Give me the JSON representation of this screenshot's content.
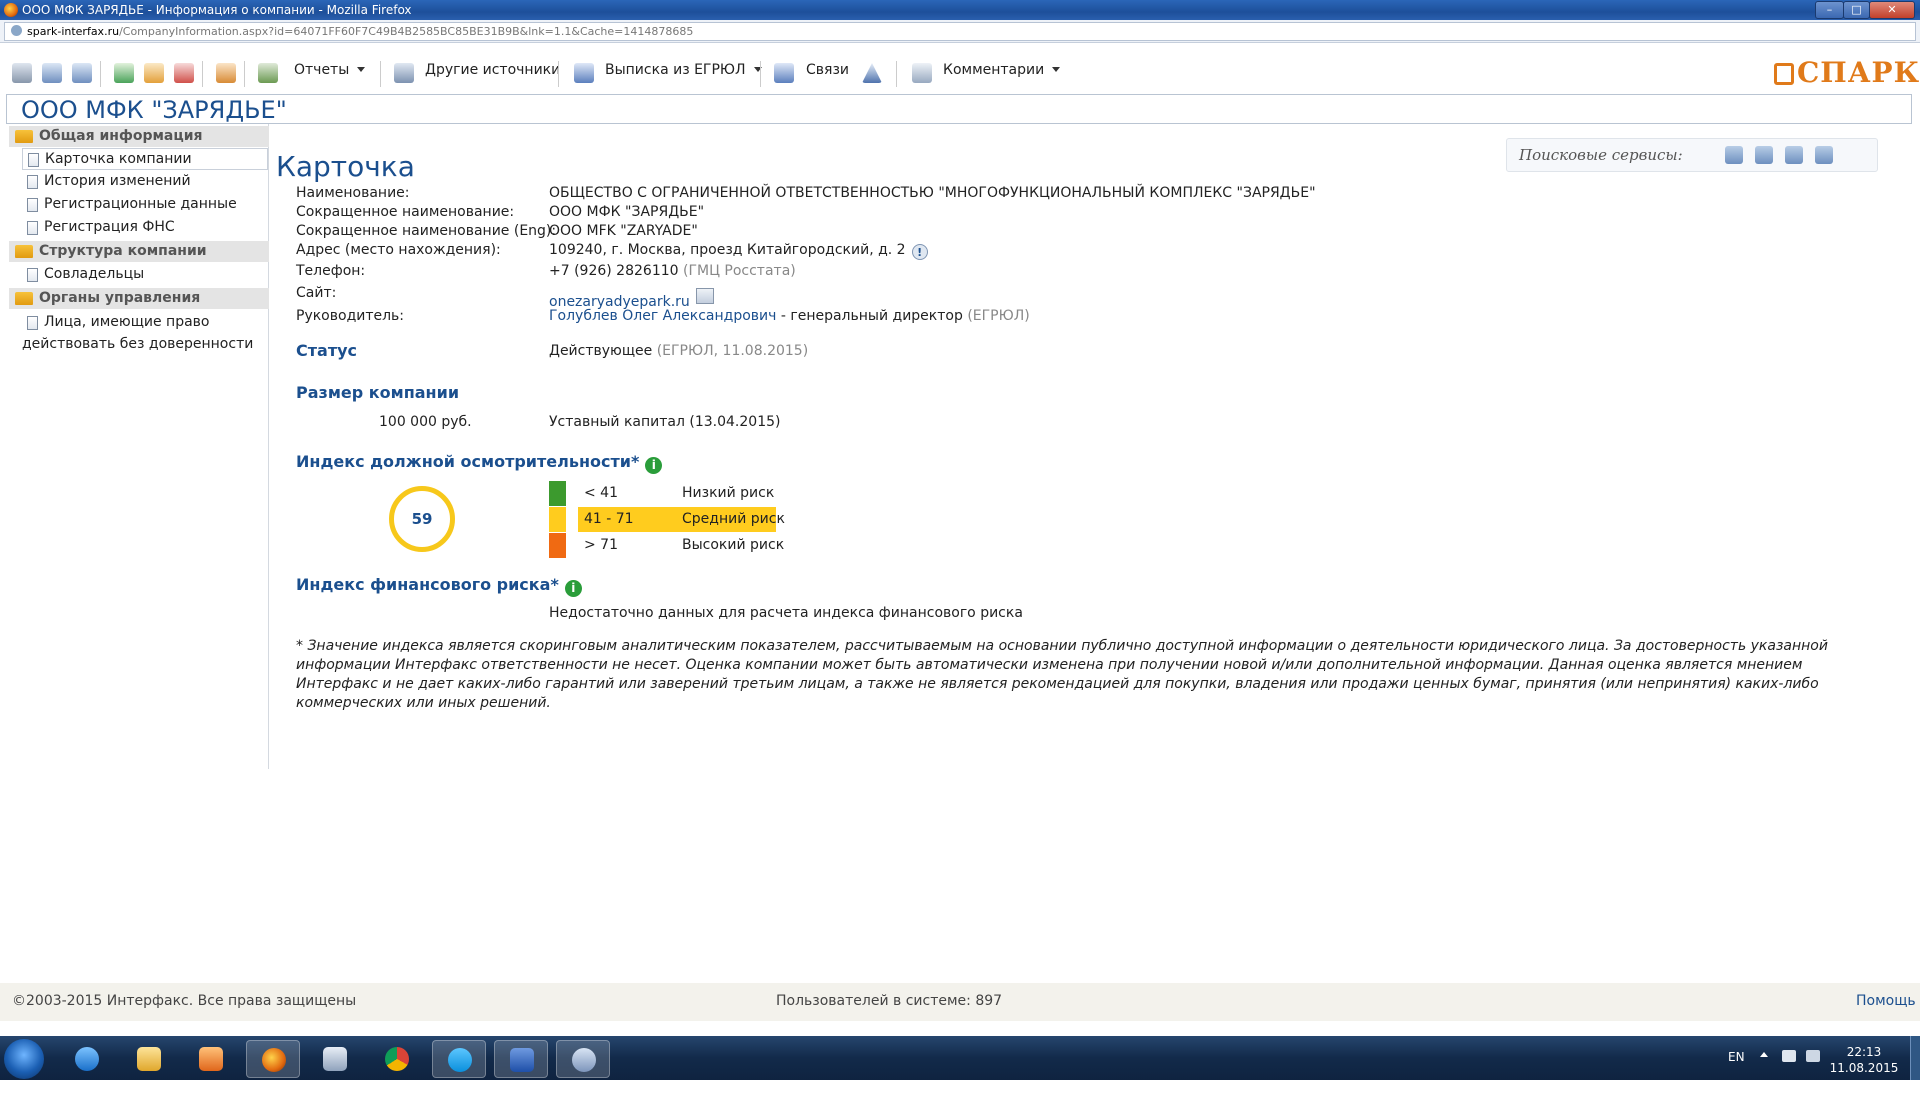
{
  "window": {
    "title": "ООО МФК ЗАРЯДЬЕ - Информация о компании - Mozilla Firefox"
  },
  "address": {
    "domain": "spark-interfax.ru",
    "path": "/CompanyInformation.aspx?id=64071FF60F7C49B4B2585BC85BE31B9B&lnk=1.1&Cache=1414878685"
  },
  "toolbar": {
    "reports": "Отчеты",
    "other_sources": "Другие источники",
    "egrul": "Выписка из ЕГРЮЛ",
    "links": "Связи",
    "comments": "Комментарии",
    "logo": "СПАРК"
  },
  "header": {
    "company": "ООО МФК \"ЗАРЯДЬЕ\""
  },
  "sidebar": {
    "groups": [
      {
        "label": "Общая информация",
        "items": [
          "Карточка компании",
          "История изменений",
          "Регистрационные данные",
          "Регистрация ФНС"
        ]
      },
      {
        "label": "Структура компании",
        "items": [
          "Совладельцы"
        ]
      },
      {
        "label": "Органы управления",
        "items": [
          "Лица, имеющие право",
          "действовать без доверенности"
        ]
      }
    ]
  },
  "search_services": {
    "label": "Поисковые сервисы:"
  },
  "card": {
    "title": "Карточка",
    "fields": [
      {
        "label": "Наименование:",
        "value": "ОБЩЕСТВО С ОГРАНИЧЕННОЙ ОТВЕТСТВЕННОСТЬЮ \"МНОГОФУНКЦИОНАЛЬНЫЙ КОМПЛЕКС \"ЗАРЯДЬЕ\""
      },
      {
        "label": "Сокращенное наименование:",
        "value": "ООО МФК \"ЗАРЯДЬЕ\""
      },
      {
        "label": "Сокращенное наименование (Eng):",
        "value": "OOO MFK \"ZARYADE\""
      },
      {
        "label": "Адрес (место нахождения):",
        "value": "109240, г. Москва, проезд Китайгородский, д. 2"
      },
      {
        "label": "Телефон:",
        "value": "+7 (926) 2826110",
        "note": "(ГМЦ Росстата)"
      },
      {
        "label": "Сайт:",
        "value": "onezaryadyepark.ru"
      },
      {
        "label": "Руководитель:",
        "value": "Голублев Олег Александрович",
        "role": " - генеральный директор ",
        "note": "(ЕГРЮЛ)"
      }
    ],
    "status": {
      "label": "Статус",
      "value": "Действующее",
      "note": "(ЕГРЮЛ, 11.08.2015)"
    },
    "size": {
      "label": "Размер компании",
      "amount": "100 000 руб.",
      "desc": "Уставный капитал (13.04.2015)"
    },
    "due_diligence": {
      "label": "Индекс должной осмотрительности*",
      "score": "59",
      "legend": [
        {
          "range": "< 41",
          "text": "Низкий риск",
          "color": "#3c9a2e"
        },
        {
          "range": "41 - 71",
          "text": "Средний риск",
          "color": "#ffcc1e"
        },
        {
          "range": "> 71",
          "text": "Высокий риск",
          "color": "#f06a12"
        }
      ]
    },
    "financial_risk": {
      "label": "Индекс финансового риска*",
      "value": "Недостаточно данных для расчета индекса финансового риска"
    },
    "info_glyph": "i",
    "excl_glyph": "!",
    "disclaimer": "* Значение индекса является скоринговым аналитическим показателем, рассчитываемым на основании публично доступной информации о деятельности юридического лица. За достоверность указанной информации Интерфакс ответственности не несет. Оценка компании может быть автоматически изменена при получении новой и/или дополнительной информации. Данная оценка является мнением Интерфакс и не дает каких-либо гарантий или заверений третьим лицам, а также не является рекомендацией для покупки, владения или продажи ценных бумаг, принятия (или непринятия) каких-либо коммерческих или иных решений."
  },
  "footer": {
    "copyright": "©2003-2015 Интерфакс. Все права защищены",
    "users": "Пользователей в системе:  897",
    "help": "Помощь"
  },
  "taskbar": {
    "lang": "EN",
    "time": "22:13",
    "date": "11.08.2015"
  }
}
